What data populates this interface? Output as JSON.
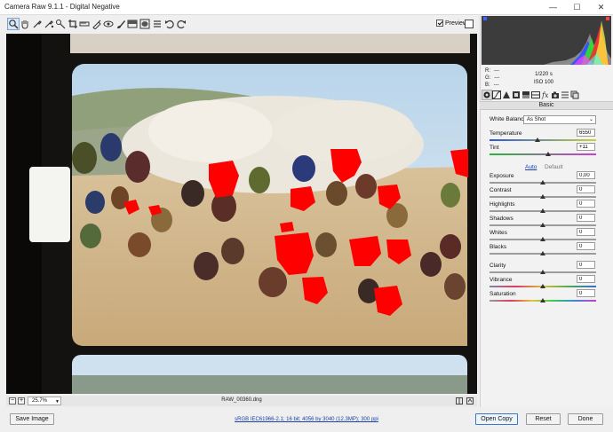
{
  "window": {
    "title": "Camera Raw 9.1.1  -  Digital Negative",
    "minimize": "—",
    "maximize": "☐",
    "close": "✕"
  },
  "toolbar": {
    "tools": [
      "zoom-icon",
      "hand-icon",
      "white-balance-icon",
      "color-sampler-icon",
      "targeted-adjustment-icon",
      "crop-icon",
      "straighten-icon",
      "spot-removal-icon",
      "red-eye-icon",
      "adjustment-brush-icon",
      "graduated-filter-icon",
      "radial-filter-icon",
      "open-preferences-icon",
      "rotate-left-icon",
      "rotate-right-icon"
    ],
    "preview_label": "Preview",
    "preview_checked": true
  },
  "statusbar": {
    "zoom_out": "−",
    "zoom_in": "+",
    "zoom_value": "25.7%",
    "filename": "RAW_00360.dng"
  },
  "bottom": {
    "save_label": "Save Image",
    "workflow_link": "sRGB IEC61966-2.1; 16 bit; 4056 by 3040 (12.3MP); 300 ppi",
    "open_label": "Open Copy",
    "reset_label": "Reset",
    "done_label": "Done"
  },
  "readout": {
    "r_label": "R:",
    "r_value": "---",
    "g_label": "G:",
    "g_value": "---",
    "b_label": "B:",
    "b_value": "---",
    "shutter": "1/220 s",
    "iso": "ISO 100"
  },
  "panel": {
    "tabs": [
      "basic-tab-icon",
      "tone-curve-tab-icon",
      "detail-tab-icon",
      "hsl-tab-icon",
      "split-toning-tab-icon",
      "lens-corrections-tab-icon",
      "fx-tab-icon",
      "camera-calibration-tab-icon",
      "presets-tab-icon",
      "snapshots-tab-icon"
    ],
    "section_title": "Basic",
    "white_balance_label": "White Balance:",
    "white_balance_value": "As Shot",
    "temperature": {
      "label": "Temperature",
      "value": "6550",
      "level": 0.45
    },
    "tint": {
      "label": "Tint",
      "value": "+11",
      "level": 0.55
    },
    "auto_label": "Auto",
    "default_label": "Default",
    "exposure": {
      "label": "Exposure",
      "value": "0,00",
      "level": 0.5
    },
    "contrast": {
      "label": "Contrast",
      "value": "0",
      "level": 0.5
    },
    "highlights": {
      "label": "Highlights",
      "value": "0",
      "level": 0.5
    },
    "shadows": {
      "label": "Shadows",
      "value": "0",
      "level": 0.5
    },
    "whites": {
      "label": "Whites",
      "value": "0",
      "level": 0.5
    },
    "blacks": {
      "label": "Blacks",
      "value": "0",
      "level": 0.5
    },
    "clarity": {
      "label": "Clarity",
      "value": "0",
      "level": 0.5
    },
    "vibrance": {
      "label": "Vibrance",
      "value": "0",
      "level": 0.5
    },
    "saturation": {
      "label": "Saturation",
      "value": "0",
      "level": 0.5
    }
  },
  "colors": {
    "clip_warning": "#ff0000",
    "accent": "#3b78c6",
    "link": "#1a3fa8"
  }
}
